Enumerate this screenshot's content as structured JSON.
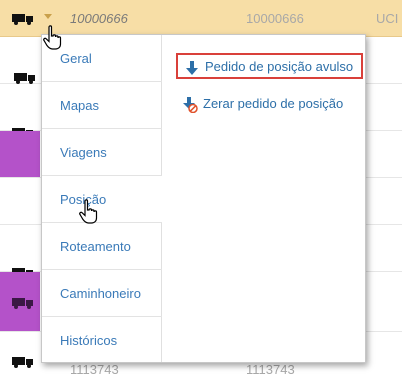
{
  "rows": [
    {
      "id": "10000666",
      "code": "10000666",
      "extra": "UCI"
    },
    {
      "id": "",
      "code": "",
      "extra": ""
    },
    {
      "id": "",
      "code": "",
      "extra": ""
    },
    {
      "id": "",
      "code": "",
      "extra": ""
    },
    {
      "id": "",
      "code": "",
      "extra": ""
    },
    {
      "id": "",
      "code": "",
      "extra": ""
    },
    {
      "id": "",
      "code": "",
      "extra": ""
    },
    {
      "id": "1113743",
      "code": "1113743",
      "extra": ""
    }
  ],
  "icon_names": [
    "truck-icon",
    "chevron-down-icon",
    "hand-cursor-icon",
    "arrow-down-icon",
    "cancel-arrow-icon"
  ],
  "colors": {
    "selected_row": "#f7dea6",
    "purple_cell": "#b452c9",
    "link": "#2d6fa8",
    "highlight_border": "#d9403a"
  },
  "menu": {
    "items": [
      {
        "label": "Geral"
      },
      {
        "label": "Mapas"
      },
      {
        "label": "Viagens"
      },
      {
        "label": "Posição"
      },
      {
        "label": "Roteamento"
      },
      {
        "label": "Caminhoneiro"
      },
      {
        "label": "Históricos"
      }
    ],
    "actions": [
      {
        "label": "Pedido de posição avulso"
      },
      {
        "label": "Zerar pedido de posição"
      }
    ]
  }
}
